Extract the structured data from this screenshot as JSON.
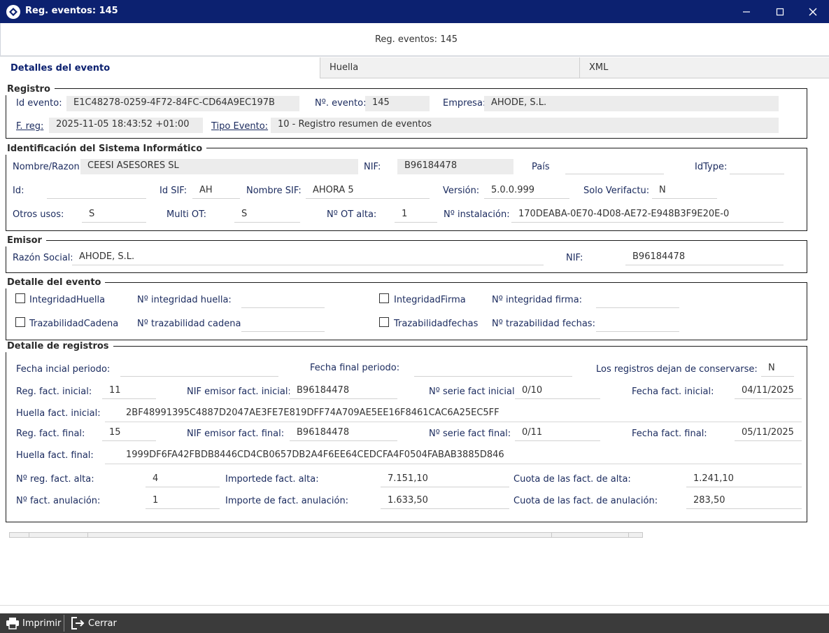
{
  "window": {
    "title": "Reg. eventos: 145",
    "minimize_icon": "minimize-icon",
    "maximize_icon": "maximize-icon",
    "close_icon": "close-icon"
  },
  "header": {
    "title": "Reg. eventos: 145"
  },
  "tabs": [
    {
      "label": "Detalles del evento",
      "active": true
    },
    {
      "label": "Huella",
      "active": false
    },
    {
      "label": "XML",
      "active": false
    }
  ],
  "registro": {
    "legend": "Registro",
    "id_evento_label": "Id evento:",
    "id_evento": "E1C48278-0259-4F72-84FC-CD64A9EC197B",
    "n_evento_label": "Nº. evento:",
    "n_evento": "145",
    "empresa_label": "Empresa:",
    "empresa": "AHODE, S.L.",
    "f_reg_label": "F. reg:",
    "f_reg": "2025-11-05 18:43:52 +01:00",
    "tipo_evento_label": "Tipo Evento:",
    "tipo_evento": "10 - Registro resumen de eventos"
  },
  "sistema": {
    "legend": "Identificación del Sistema Informático",
    "nombre_razon_label": "Nombre/Razon:",
    "nombre_razon": "CEESI ASESORES SL",
    "nif_label": "NIF:",
    "nif": "B96184478",
    "pais_label": "País",
    "pais": "",
    "idtype_label": "IdType:",
    "idtype": "",
    "id_label": "Id:",
    "id": "",
    "id_sif_label": "Id SIF:",
    "id_sif": "AH",
    "nombre_sif_label": "Nombre SIF:",
    "nombre_sif": "AHORA 5",
    "version_label": "Versión:",
    "version": "5.0.0.999",
    "solo_verifactu_label": "Solo Verifactu:",
    "solo_verifactu": "N",
    "otros_usos_label": "Otros usos:",
    "otros_usos": "S",
    "multi_ot_label": "Multi OT:",
    "multi_ot": "S",
    "n_ot_alta_label": "Nº OT alta:",
    "n_ot_alta": "1",
    "n_instalacion_label": "Nº instalación:",
    "n_instalacion": "170DEABA-0E70-4D08-AE72-E948B3F9E20E-0"
  },
  "emisor": {
    "legend": "Emisor",
    "razon_social_label": "Razón Social:",
    "razon_social": "AHODE, S.L.",
    "nif_label": "NIF:",
    "nif": "B96184478"
  },
  "detalle_evento": {
    "legend": "Detalle del evento",
    "integridad_huella_label": "IntegridadHuella",
    "integridad_huella_checked": false,
    "n_integridad_huella_label": "Nº integridad huella:",
    "n_integridad_huella": "",
    "integridad_firma_label": "IntegridadFirma",
    "integridad_firma_checked": false,
    "n_integridad_firma_label": "Nº integridad firma:",
    "n_integridad_firma": "",
    "trazabilidad_cadena_label": "TrazabilidadCadena",
    "trazabilidad_cadena_checked": false,
    "n_trazabilidad_cadena_label": "Nº trazabilidad cadena:",
    "n_trazabilidad_cadena": "",
    "trazabilidad_fechas_label": "Trazabilidadfechas",
    "trazabilidad_fechas_checked": false,
    "n_trazabilidad_fechas_label": "Nº trazabilidad fechas:",
    "n_trazabilidad_fechas": ""
  },
  "detalle_registros": {
    "legend": "Detalle de registros",
    "fecha_inicial_periodo_label": "Fecha incial periodo:",
    "fecha_inicial_periodo": "",
    "fecha_final_periodo_label": "Fecha final periodo:",
    "fecha_final_periodo": "",
    "dejan_conservarse_label": "Los registros dejan de conservarse:",
    "dejan_conservarse": "N",
    "reg_fact_inicial_label": "Reg. fact. inicial:",
    "reg_fact_inicial": "11",
    "nif_emisor_inicial_label": "NIF emisor fact. inicial:",
    "nif_emisor_inicial": "B96184478",
    "serie_inicial_label": "Nº serie fact inicial:",
    "serie_inicial": "0/10",
    "fecha_fact_inicial_label": "Fecha fact. inicial:",
    "fecha_fact_inicial": "04/11/2025",
    "huella_inicial_label": "Huella fact. inicial:",
    "huella_inicial": "2BF48991395C4887D2047AE3FE7E819DFF74A709AE5EE16F8461CAC6A25EC5FF",
    "reg_fact_final_label": "Reg. fact. final:",
    "reg_fact_final": "15",
    "nif_emisor_final_label": "NIF emisor fact. final:",
    "nif_emisor_final": "B96184478",
    "serie_final_label": "Nº serie fact final:",
    "serie_final": "0/11",
    "fecha_fact_final_label": "Fecha fact. final:",
    "fecha_fact_final": "05/11/2025",
    "huella_final_label": "Huella fact. final:",
    "huella_final": "1999DF6FA42FBDB8446CD4CB0657DB2A4F6EE64CEDCFA4F0504FABAB3885D846",
    "n_reg_alta_label": "Nº reg. fact. alta:",
    "n_reg_alta": "4",
    "importe_alta_label": "Importede fact. alta:",
    "importe_alta": "7.151,10",
    "cuota_alta_label": "Cuota de las fact. de alta:",
    "cuota_alta": "1.241,10",
    "n_anulacion_label": "Nº fact. anulación:",
    "n_anulacion": "1",
    "importe_anulacion_label": "Importe de fact. anulación:",
    "importe_anulacion": "1.633,50",
    "cuota_anulacion_label": "Cuota de las fact. de anulación:",
    "cuota_anulacion": "283,50"
  },
  "footer": {
    "imprimir_label": "Imprimir",
    "imprimir_icon": "printer-icon",
    "cerrar_label": "Cerrar",
    "cerrar_icon": "exit-icon"
  }
}
